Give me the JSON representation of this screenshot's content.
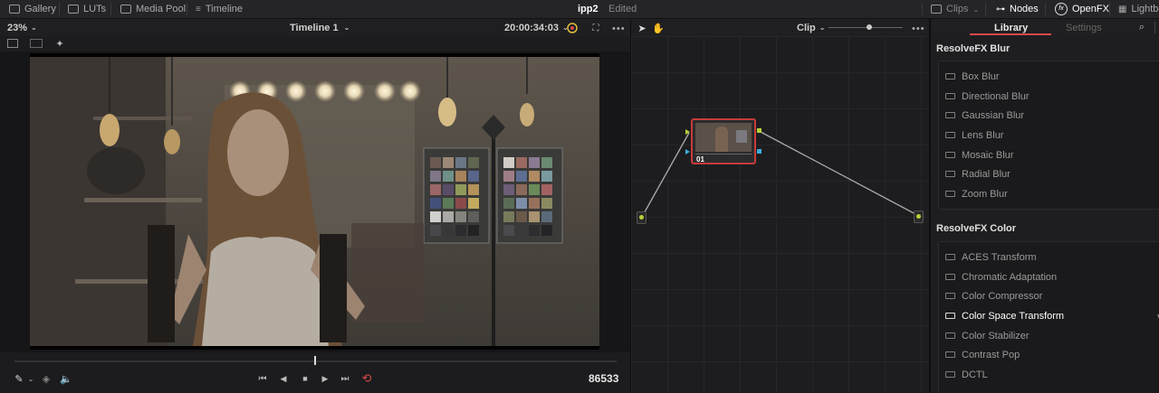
{
  "topbar": {
    "gallery": "Gallery",
    "luts": "LUTs",
    "media_pool": "Media Pool",
    "timeline": "Timeline",
    "project_name": "ipp2",
    "project_status": "Edited",
    "clips": "Clips",
    "nodes": "Nodes",
    "openfx": "OpenFX",
    "lightbox": "Lightbo"
  },
  "viewer": {
    "zoom": "23%",
    "timeline_name": "Timeline 1",
    "timecode": "20:00:34:03",
    "frame_number": "86533"
  },
  "node_editor": {
    "mode": "Clip",
    "node_label": "01"
  },
  "library": {
    "tab_library": "Library",
    "tab_settings": "Settings",
    "sections": [
      {
        "title": "ResolveFX Blur",
        "items": [
          "Box Blur",
          "Directional Blur",
          "Gaussian Blur",
          "Lens Blur",
          "Mosaic Blur",
          "Radial Blur",
          "Zoom Blur"
        ]
      },
      {
        "title": "ResolveFX Color",
        "items": [
          "ACES Transform",
          "Chromatic Adaptation",
          "Color Compressor",
          "Color Space Transform",
          "Color Stabilizer",
          "Contrast Pop",
          "DCTL"
        ]
      }
    ],
    "highlighted_item": "Color Space Transform"
  },
  "colors": {
    "accent_red": "#d94a4a",
    "node_green": "#b7d33a",
    "node_blue": "#3ab0e0"
  }
}
